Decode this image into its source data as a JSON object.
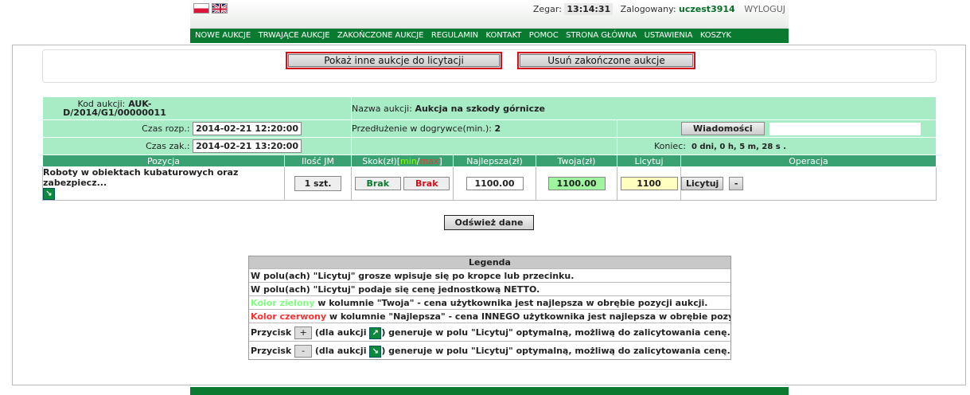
{
  "header": {
    "clock_label": "Zegar:",
    "clock_value": "13:14:31",
    "logged_label": "Zalogowany:",
    "username": "uczest3914",
    "logout": "WYLOGUJ"
  },
  "nav": [
    "NOWE AUKCJE",
    "TRWAJĄCE AUKCJE",
    "ZAKOŃCZONE AUKCJE",
    "REGULAMIN",
    "KONTAKT",
    "POMOC",
    "STRONA GŁÓWNA",
    "USTAWIENIA",
    "KOSZYK"
  ],
  "actions": {
    "show_other": "Pokaż inne aukcje do licytacji",
    "remove_finished": "Usuń zakończone aukcje"
  },
  "auction": {
    "code_label": "Kod aukcji:",
    "code_value": "AUK-D/2014/G1/00000011",
    "name_label": "Nazwa aukcji:",
    "name_value": "Aukcja na szkody górnicze",
    "start_label": "Czas rozp.:",
    "start_value": "2014-02-21 12:20:00",
    "extension_label": "Przedłużenie w dogrywce(min.):",
    "extension_value": "2",
    "messages_button": "Wiadomości",
    "end_label": "Czas zak.:",
    "end_value": "2014-02-21 13:20:00",
    "remaining_label": "Koniec:",
    "remaining_value": "0 dni, 0 h, 5 m, 28 s ."
  },
  "columns": {
    "position": "Pozycja",
    "qty": "Ilość JM",
    "step": "Skok(zł)[",
    "step_min": "min",
    "step_sep": "/",
    "step_max": "max",
    "step_end": "]",
    "best": "Najlepsza(zł)",
    "yours": "Twoja(zł)",
    "bid": "Licytuj",
    "operation": "Operacja"
  },
  "row": {
    "position": "Roboty w obiektach kubaturowych oraz zabezpiecz...",
    "qty": "1 szt.",
    "step_min": "Brak",
    "step_max": "Brak",
    "best": "1100.00",
    "yours": "1100.00",
    "bid": "1100",
    "bid_button": "Licytuj",
    "minus_button": "-"
  },
  "refresh_button": "Odśwież dane",
  "legend": {
    "title": "Legenda",
    "line1": "W polu(ach) \"Licytuj\" grosze wpisuje się po kropce lub przecinku.",
    "line2": "W polu(ach) \"Licytuj\" podaje się cenę jednostkową NETTO.",
    "line3_color": "Kolor zielony",
    "line3_rest": " w kolumnie \"Twoja\" - cena użytkownika jest najlepsza w obrębie pozycji aukcji.",
    "line4_color": "Kolor czerwony",
    "line4_rest": " w kolumnie \"Najlepsza\" - cena INNEGO użytkownika jest najlepsza w obrębie pozycji aukcji.",
    "btn_label": "Przycisk",
    "plus": "+",
    "minus": "-",
    "for_auction": "(dla aukcji",
    "line5_rest": ") generuje w polu \"Licytuj\" optymalną, możliwą do zalicytowania cenę.",
    "line6_rest": ") generuje w polu \"Licytuj\" optymalną, możliwą do zalicytowania cenę."
  },
  "colors": {
    "nav_bg": "#0a7a30",
    "cell_bg": "#a8ecc6",
    "header_bg": "#3aa272",
    "alert_red": "#d4101c"
  }
}
